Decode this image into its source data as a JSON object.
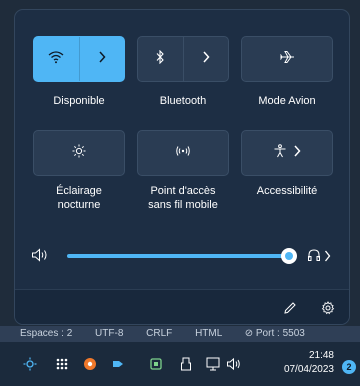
{
  "quick_settings": {
    "wifi": {
      "label": "Disponible",
      "active": true
    },
    "bluetooth": {
      "label": "Bluetooth",
      "active": false
    },
    "airplane": {
      "label": "Mode Avion",
      "active": false
    },
    "night_light": {
      "label_line1": "Éclairage",
      "label_line2": "nocturne",
      "active": false
    },
    "hotspot": {
      "label_line1": "Point d'accès",
      "label_line2": "sans fil mobile",
      "active": false
    },
    "accessibility": {
      "label": "Accessibilité",
      "active": false
    }
  },
  "volume": {
    "level_percent": 100
  },
  "editor_status": {
    "spaces": "Espaces : 2",
    "encoding": "UTF-8",
    "eol": "CRLF",
    "language": "HTML",
    "port": "Port : 5503"
  },
  "taskbar": {
    "time": "21:48",
    "date": "07/04/2023",
    "notification_count": "2"
  },
  "colors": {
    "accent": "#4fb6f5",
    "panel_bg": "#1d2e44",
    "tile_bg": "#2a3c53"
  }
}
